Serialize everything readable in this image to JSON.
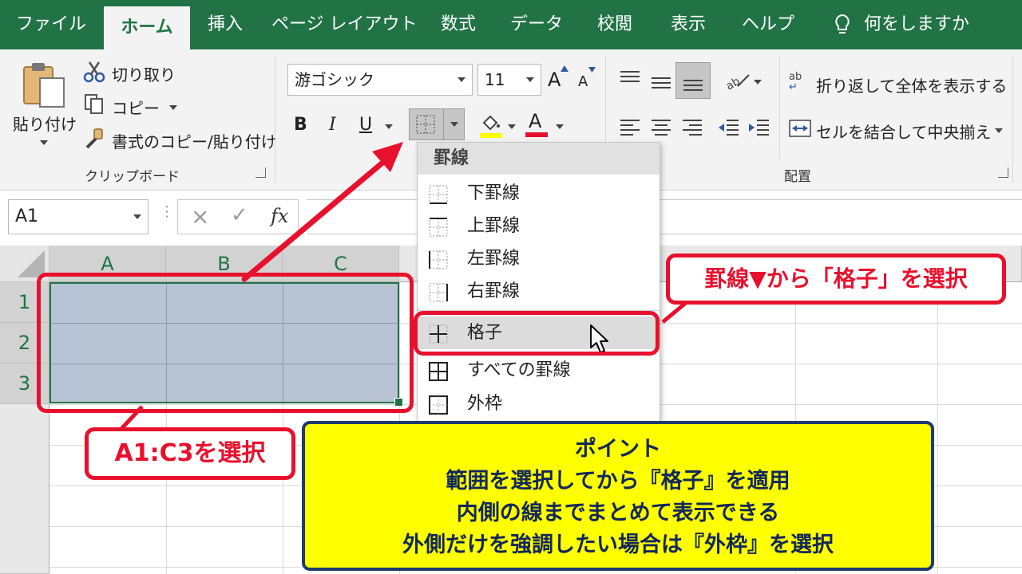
{
  "tabs": [
    {
      "label": "ファイル",
      "active": false
    },
    {
      "label": "ホーム",
      "active": true
    },
    {
      "label": "挿入",
      "active": false
    },
    {
      "label": "ページ レイアウト",
      "active": false
    },
    {
      "label": "数式",
      "active": false
    },
    {
      "label": "データ",
      "active": false
    },
    {
      "label": "校閲",
      "active": false
    },
    {
      "label": "表示",
      "active": false
    },
    {
      "label": "ヘルプ",
      "active": false
    }
  ],
  "tell_me": "何をしますか",
  "clipboard": {
    "paste": "貼り付け",
    "cut": "切り取り",
    "copy": "コピー",
    "format_painter": "書式のコピー/貼り付け",
    "group_label": "クリップボード"
  },
  "font": {
    "name": "游ゴシック",
    "size": "11",
    "bold": "B",
    "italic": "I",
    "underline": "U",
    "font_color_letter": "A",
    "grow_letter": "A",
    "shrink_letter": "A"
  },
  "alignment": {
    "wrap_text": "折り返して全体を表示する",
    "merge_center": "セルを結合して中央揃え",
    "group_label": "配置",
    "wrap_icon_text": "ab"
  },
  "formula_bar": {
    "name_box": "A1",
    "cancel": "×",
    "enter": "✓",
    "fx": "fx"
  },
  "grid": {
    "columns": [
      "A",
      "B",
      "C"
    ],
    "rows": [
      "1",
      "2",
      "3"
    ]
  },
  "borders_menu": {
    "header": "罫線",
    "items": [
      {
        "label": "下罫線",
        "icon": "bottom-border-icon"
      },
      {
        "label": "上罫線",
        "icon": "top-border-icon"
      },
      {
        "label": "左罫線",
        "icon": "left-border-icon"
      },
      {
        "label": "右罫線",
        "icon": "right-border-icon"
      },
      {
        "label": "格子",
        "icon": "inside-grid-border-icon",
        "highlighted": true
      },
      {
        "label": "すべての罫線",
        "icon": "all-borders-icon"
      },
      {
        "label": "外枠",
        "icon": "outside-border-icon"
      }
    ]
  },
  "annotations": {
    "select_grid": "罫線▼から「格子」を選択",
    "select_range": "A1:C3を選択",
    "point_lines": [
      "ポイント",
      "範囲を選択してから『格子』を適用",
      "内側の線までまとめて表示できる",
      "外側だけを強調したい場合は『外枠』を選択"
    ]
  },
  "colors": {
    "excel_green": "#217346",
    "annotation_red": "#e8112d",
    "point_yellow": "#ffff00",
    "point_border": "#1f3a6e",
    "selection_fill": "#b8c3d3"
  }
}
